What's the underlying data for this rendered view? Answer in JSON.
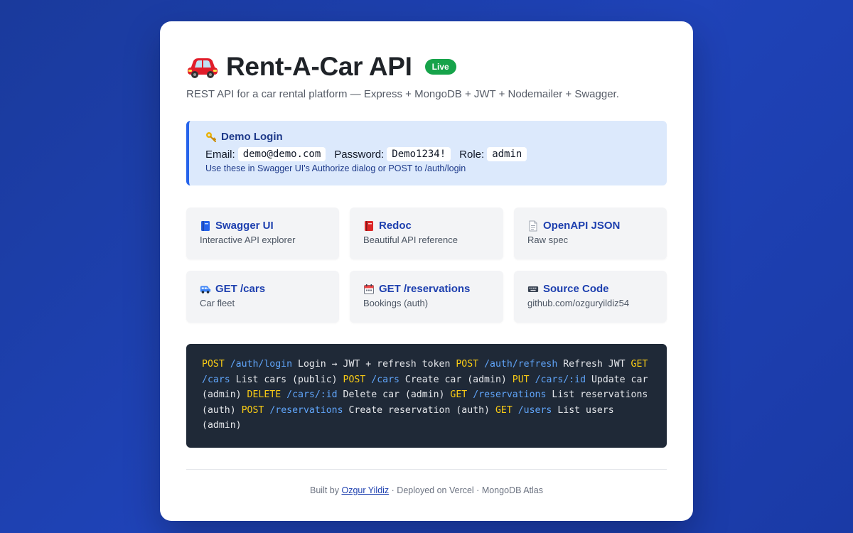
{
  "header": {
    "icon": "car-icon",
    "title": "Rent-A-Car API",
    "badge": "Live",
    "subtitle": "REST API for a car rental platform — Express + MongoDB + JWT + Nodemailer + Swagger."
  },
  "demo": {
    "icon": "key-icon",
    "title": "Demo Login",
    "email_label": "Email:",
    "email": "demo@demo.com",
    "password_label": "Password:",
    "password": "Demo1234!",
    "role_label": "Role:",
    "role": "admin",
    "note": "Use these in Swagger UI's Authorize dialog or POST to /auth/login"
  },
  "tiles": [
    {
      "icon": "blue-book-icon",
      "title": "Swagger UI",
      "desc": "Interactive API explorer"
    },
    {
      "icon": "red-book-icon",
      "title": "Redoc",
      "desc": "Beautiful API reference"
    },
    {
      "icon": "document-icon",
      "title": "OpenAPI JSON",
      "desc": "Raw spec"
    },
    {
      "icon": "van-icon",
      "title": "GET /cars",
      "desc": "Car fleet"
    },
    {
      "icon": "calendar-icon",
      "title": "GET /reservations",
      "desc": "Bookings (auth)"
    },
    {
      "icon": "keyboard-icon",
      "title": "Source Code",
      "desc": "github.com/ozguryildiz54"
    }
  ],
  "endpoints": [
    {
      "method": "POST",
      "path": "/auth/login",
      "desc": "Login → JWT + refresh token"
    },
    {
      "method": "POST",
      "path": "/auth/refresh",
      "desc": "Refresh JWT"
    },
    {
      "method": "GET",
      "path": "/cars",
      "desc": "List cars (public)"
    },
    {
      "method": "POST",
      "path": "/cars",
      "desc": "Create car (admin)"
    },
    {
      "method": "PUT",
      "path": "/cars/:id",
      "desc": "Update car (admin)"
    },
    {
      "method": "DELETE",
      "path": "/cars/:id",
      "desc": "Delete car (admin)"
    },
    {
      "method": "GET",
      "path": "/reservations",
      "desc": "List reservations (auth)"
    },
    {
      "method": "POST",
      "path": "/reservations",
      "desc": "Create reservation (auth)"
    },
    {
      "method": "GET",
      "path": "/users",
      "desc": "List users (admin)"
    }
  ],
  "footer": {
    "prefix": "Built by",
    "author": "Ozgur Yildiz",
    "suffix": "· Deployed on Vercel · MongoDB Atlas"
  },
  "colors": {
    "background": "#1f43b8",
    "badge": "#16a34a",
    "accent": "#2563eb",
    "method": "#facc15",
    "path": "#60a5fa"
  }
}
